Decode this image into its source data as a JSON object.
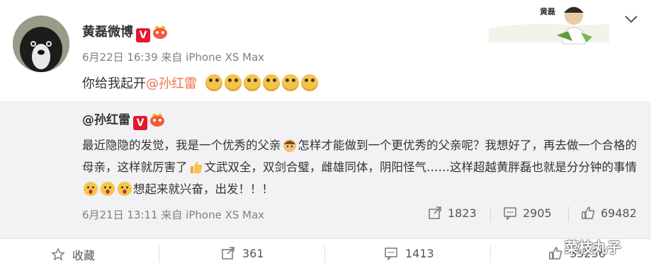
{
  "post": {
    "username": "黄磊微博",
    "verified_badge": "V",
    "date": "6月22日 16:39",
    "source": "来自 iPhone XS Max",
    "text_prefix": "你给我起开",
    "mention": "@孙红雷"
  },
  "header_art": {
    "label": "黄磊"
  },
  "repost": {
    "username": "@孙红雷",
    "verified_badge": "V",
    "text_part1": "最近隐隐的发觉，我是一个优秀的父亲",
    "text_part2": "怎样才能做到一个更优秀的父亲呢？我想好了，再去做一个合格的母亲，这样就厉害了",
    "text_part3": "文武双全，双剑合璧，雌雄同体，阴阳怪气……这样超越黄胖磊也就是分分钟的事情",
    "text_part4": "想起来就兴奋，出发！！！",
    "date": "6月21日 13:11",
    "source": "来自 iPhone XS Max",
    "stats": {
      "reposts": "1823",
      "comments": "2905",
      "likes": "69482"
    }
  },
  "actions": {
    "favorite": "收藏",
    "reposts": "361",
    "comments": "1413",
    "likes": "33236"
  },
  "watermark": "菜枝丸子",
  "colors": {
    "mention": "#eb7350",
    "verified": "#e6162d",
    "repost_bg": "#f2f2f5"
  }
}
